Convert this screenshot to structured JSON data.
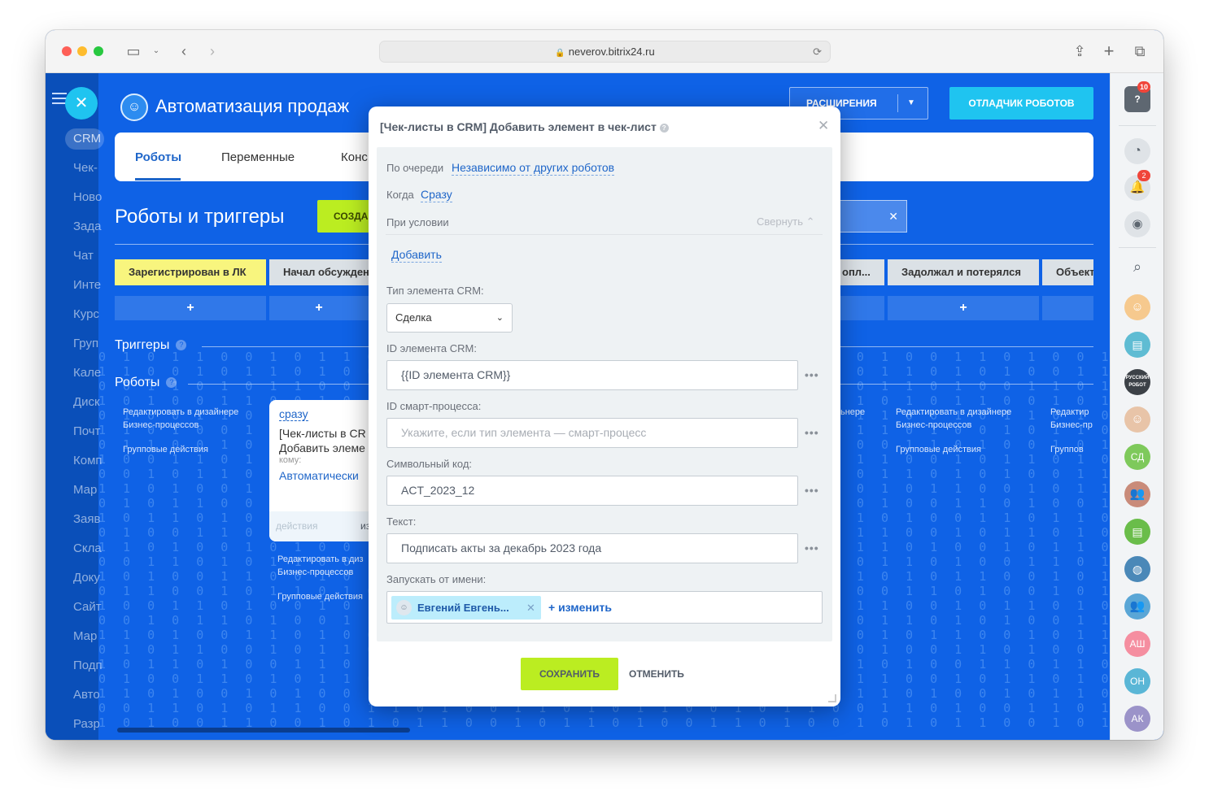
{
  "browser": {
    "url": "neverov.bitrix24.ru"
  },
  "leftnav": {
    "crm": "CRM",
    "items": [
      "Чек-",
      "Ново",
      "Зада",
      "Чат",
      "Инте",
      "Курс",
      "Груп",
      "Кале",
      "Диск",
      "Почт",
      "Комп",
      "Мар",
      "Заяв",
      "Скла",
      "Доку",
      "Сайт",
      "Мар",
      "Подп",
      "Авто",
      "Разр"
    ]
  },
  "header": {
    "title": "Автоматизация продаж",
    "extensions_label": "РАСШИРЕНИЯ",
    "debugger_label": "ОТЛАДЧИК РОБОТОВ"
  },
  "tabs": [
    {
      "label": "Роботы"
    },
    {
      "label": "Переменные"
    },
    {
      "label": "Конс"
    }
  ],
  "section": {
    "title": "Роботы и триггеры",
    "create_label": "СОЗДА"
  },
  "stages": [
    {
      "label": "Зарегистрирован в ЛК"
    },
    {
      "label": "Начал обсужден"
    },
    {
      "label": "опл..."
    },
    {
      "label": "Задолжал и потерялся"
    },
    {
      "label": "Объект"
    }
  ],
  "triggers_label": "Триггеры",
  "robots_label": "Роботы",
  "column_links": {
    "edit_line1": "Редактировать в дизайнере",
    "edit_line2": "Бизнес-процессов",
    "group_actions": "Групповые действия",
    "edit_trunc": "Редактир",
    "edit_bp_trunc": "Бизнес-пр",
    "group_trunc": "Группов",
    "edit_bp_right": "ьнере",
    "edit_line1_mid": "Редактировать в диз",
    "group_actions_mid": "Групповые действия"
  },
  "robot_card": {
    "when": "сразу",
    "name_line1": "[Чек-листы в CR",
    "name_line2": "Добавить элеме",
    "to_label": "кому:",
    "assignee": "Автоматически",
    "footer": "действия",
    "footer_right": "из"
  },
  "modal": {
    "title": "[Чек-листы в CRM] Добавить элемент в чек-лист",
    "queue_label": "По очереди",
    "queue_value": "Независимо от других роботов",
    "when_label": "Когда",
    "when_value": "Сразу",
    "condition_label": "При условии",
    "collapse_label": "Свернуть",
    "add_label": "Добавить",
    "crm_type_label": "Тип элемента CRM:",
    "crm_type_value": "Сделка",
    "crm_id_label": "ID элемента CRM:",
    "crm_id_value": "{{ID элемента CRM}}",
    "smart_label": "ID смарт-процесса:",
    "smart_placeholder": "Укажите, если тип элемента — смарт-процесс",
    "code_label": "Символьный код:",
    "code_value": "ACT_2023_12",
    "text_label": "Текст:",
    "text_value": "Подписать акты за декабрь 2023 года",
    "run_as_label": "Запускать от имени:",
    "user_name": "Евгений Евгень...",
    "change_label": "+ изменить",
    "save_label": "СОХРАНИТЬ",
    "cancel_label": "ОТМЕНИТЬ",
    "dots": "•••"
  },
  "rightbar": {
    "help_badge": "10",
    "bell_badge": "2",
    "avatars": [
      "СД",
      "АШ",
      "ОН",
      "АК"
    ],
    "robot_avatar": "РУССКИЙ РОБОТ"
  },
  "colors": {
    "accent_blue": "#0f62e6",
    "lime": "#bbed21",
    "cyan": "#1fc4f0"
  }
}
